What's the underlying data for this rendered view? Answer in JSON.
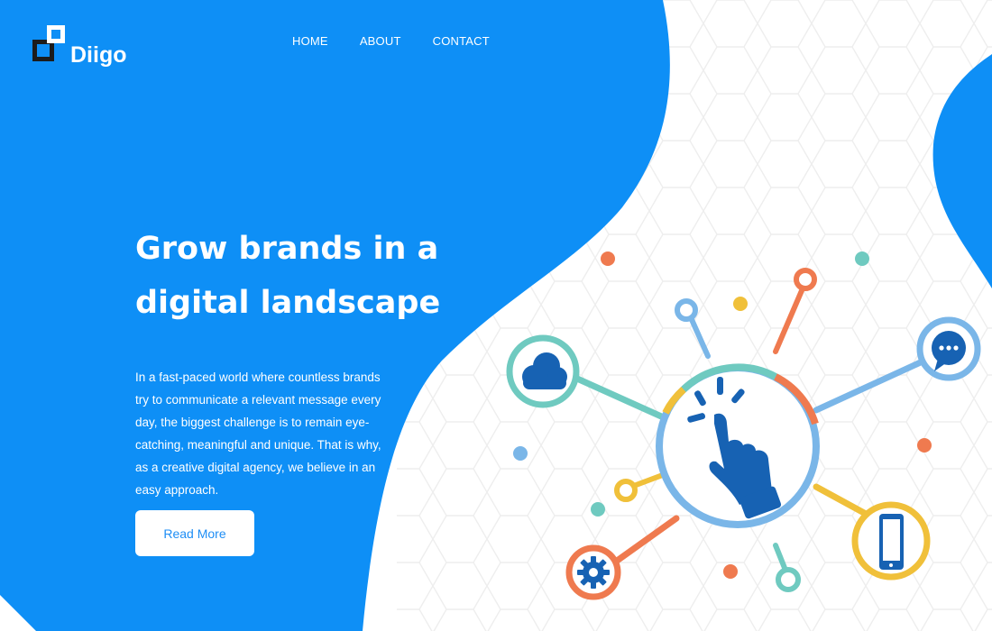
{
  "brand": {
    "name": "Diigo"
  },
  "nav": {
    "items": [
      "HOME",
      "ABOUT",
      "CONTACT"
    ]
  },
  "hero": {
    "title_line1": "Grow brands in a",
    "title_line2": "digital landscape",
    "text": "In a fast-paced world where countless brands try to communicate a relevant message every day, the biggest challenge is to remain eye-catching, meaningful and unique. That is why, as a creative digital agency, we believe in an easy approach.",
    "cta": "Read More"
  },
  "colors": {
    "primary_blue": "#0e8ff6",
    "teal": "#6fcac0",
    "orange": "#ef7a4f",
    "yellow": "#f0c03a",
    "light_blue": "#7ab6e8",
    "dark_blue": "#1762b3"
  },
  "icons": [
    "cloud-icon",
    "hand-click-icon",
    "chat-icon",
    "smartphone-icon",
    "gear-icon"
  ]
}
